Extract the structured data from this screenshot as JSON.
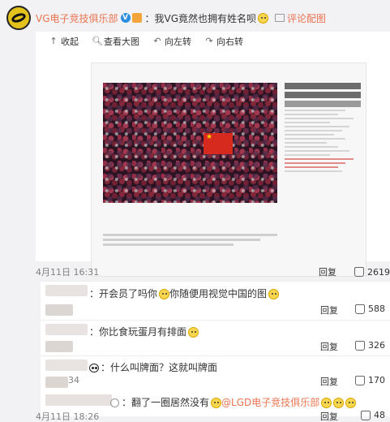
{
  "post": {
    "username": "VG电子竞技俱乐部",
    "verified_badge": "V",
    "text": "：我VG竟然也拥有姓名呗",
    "comment_image_label": "评论配图",
    "time": "4月11日 16:31",
    "reply_label": "回复",
    "likes": "2619"
  },
  "viewer": {
    "tools": [
      {
        "icon": "collapse-icon",
        "label": "收起"
      },
      {
        "icon": "zoom-icon",
        "label": "查看大图"
      },
      {
        "icon": "rotate-left-icon",
        "label": "向左转"
      },
      {
        "icon": "rotate-right-icon",
        "label": "向右转"
      }
    ]
  },
  "comments": [
    {
      "text": "：开会员了吗你",
      "text2": "你随便用视觉中国的图",
      "reply": "回复",
      "likes": "588"
    },
    {
      "text": "：你比食玩蛋月有排面",
      "reply": "回复",
      "likes": "326"
    },
    {
      "text": "：什么叫牌面？这就叫牌面",
      "time": "34",
      "reply": "回复",
      "likes": "170"
    },
    {
      "text": "：翻了一圈居然没有",
      "mention": "@LGD电子竞技俱乐部",
      "time": "4月11日 18:26",
      "reply": "回复",
      "likes": "48"
    }
  ],
  "colors": {
    "accent": "#eb7350",
    "background": "#f2f2f5"
  }
}
